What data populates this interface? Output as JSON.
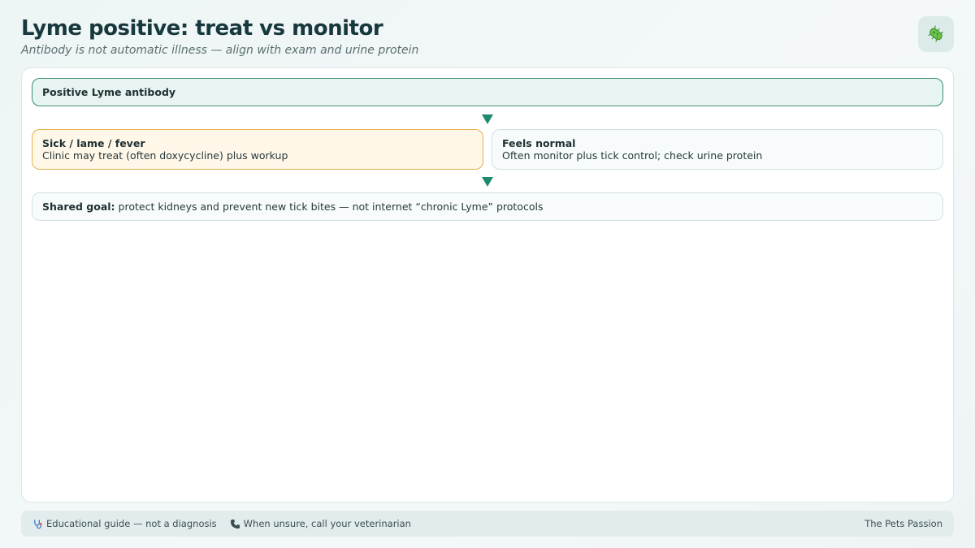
{
  "header": {
    "title": "Lyme positive: treat vs monitor",
    "subtitle": "Antibody is not automatic illness — align with exam and urine protein",
    "badge_icon": "bacteria-icon"
  },
  "flow": {
    "start": "Positive Lyme antibody",
    "branches": [
      {
        "title": "Sick / lame / fever",
        "text": "Clinic may treat (often doxycycline) plus workup"
      },
      {
        "title": "Feels normal",
        "text": "Often monitor plus tick control; check urine protein"
      }
    ],
    "goal": {
      "label": "Shared goal:",
      "text": "protect kidneys and prevent new tick bites — not internet “chronic Lyme” protocols"
    }
  },
  "footer": {
    "disclaimer": "Educational guide — not a diagnosis",
    "call": "When unsure, call your veterinarian",
    "brand": "The Pets Passion"
  },
  "colors": {
    "accent": "#1e8a6e",
    "sick_border": "#e3b34d",
    "start_border": "#3e8c79"
  }
}
